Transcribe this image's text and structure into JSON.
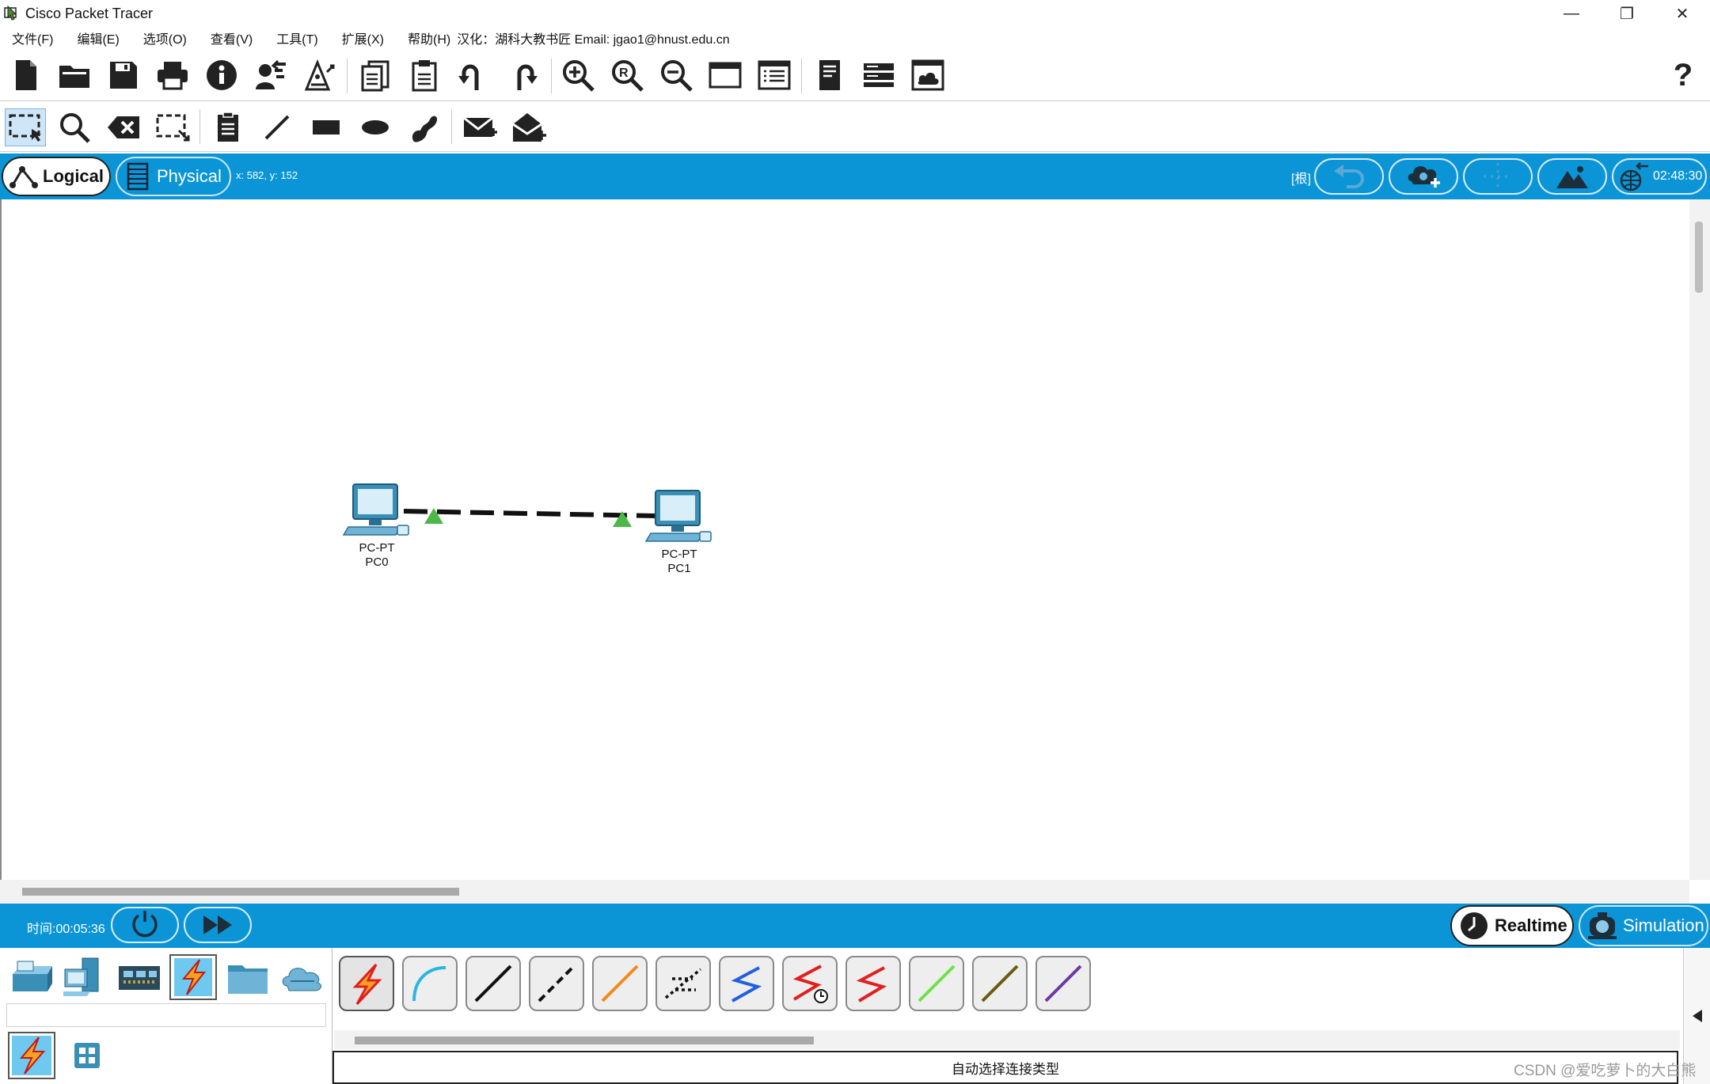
{
  "window": {
    "title": "Cisco Packet Tracer",
    "controls": [
      "—",
      "❐",
      "✕"
    ]
  },
  "menu": {
    "items": [
      "文件(F)",
      "编辑(E)",
      "选项(O)",
      "查看(V)",
      "工具(T)",
      "扩展(X)",
      "帮助(H)"
    ],
    "info": "汉化：湖科大教书匠  Email: jgao1@hnust.edu.cn"
  },
  "toolbar1": {
    "icons": [
      "new-file-icon",
      "open-folder-icon",
      "save-icon",
      "print-icon",
      "info-icon",
      "activity-wizard-icon",
      "custom-devices-icon",
      "copy-icon",
      "paste-icon",
      "undo-icon",
      "redo-icon",
      "zoom-in-icon",
      "zoom-reset-icon",
      "zoom-out-icon",
      "window-icon",
      "palette-icon",
      "ipc-icon",
      "pdu-list-icon",
      "cluster-icon",
      "help-icon"
    ],
    "help_label": "?"
  },
  "toolbar2": {
    "icons": [
      "select-icon",
      "inspect-icon",
      "delete-icon",
      "resize-icon",
      "note-icon",
      "draw-line-icon",
      "rectangle-icon",
      "ellipse-icon",
      "freeform-icon",
      "simple-pdu-icon",
      "complex-pdu-icon"
    ]
  },
  "workspace_bar": {
    "logical_label": "Logical",
    "physical_label": "Physical",
    "coords": "x: 582, y: 152",
    "root_label": "[根]",
    "clock": "02:48:30",
    "accent_color": "#0b95d6"
  },
  "canvas": {
    "devices": [
      {
        "type": "PC-PT",
        "name": "PC0"
      },
      {
        "type": "PC-PT",
        "name": "PC1"
      }
    ],
    "link": {
      "style": "crossover",
      "status_color": "#4cb848"
    }
  },
  "bottom_bar": {
    "time_label": "时间:00:05:36",
    "realtime_label": "Realtime",
    "simulation_label": "Simulation"
  },
  "device_palette": {
    "categories": [
      "network-devices-icon",
      "end-devices-icon",
      "components-icon",
      "connections-icon",
      "miscellaneous-icon",
      "multiuser-icon"
    ],
    "selected_category": "connections-icon",
    "subcategories": [
      "connections-sub-icon",
      "grid-sub-icon"
    ]
  },
  "cables": {
    "items": [
      {
        "name": "automatic-cable",
        "color": "#e02020"
      },
      {
        "name": "console-cable",
        "color": "#2ab6e0"
      },
      {
        "name": "copper-straight-through",
        "color": "#111111"
      },
      {
        "name": "copper-cross-over",
        "color": "#111111"
      },
      {
        "name": "fiber-cable",
        "color": "#f08a1c"
      },
      {
        "name": "phone-cable",
        "color": "#111111"
      },
      {
        "name": "coaxial-cable",
        "color": "#1f5fe0"
      },
      {
        "name": "serial-dce-cable",
        "color": "#e02020"
      },
      {
        "name": "serial-dte-cable",
        "color": "#e02020"
      },
      {
        "name": "octal-cable",
        "color": "#6fe04a"
      },
      {
        "name": "iot-custom-cable",
        "color": "#6b5a12"
      },
      {
        "name": "usb-cable",
        "color": "#6a38a8"
      }
    ],
    "description": "自动选择连接类型"
  },
  "watermark": "CSDN @爱吃萝卜的大白熊"
}
